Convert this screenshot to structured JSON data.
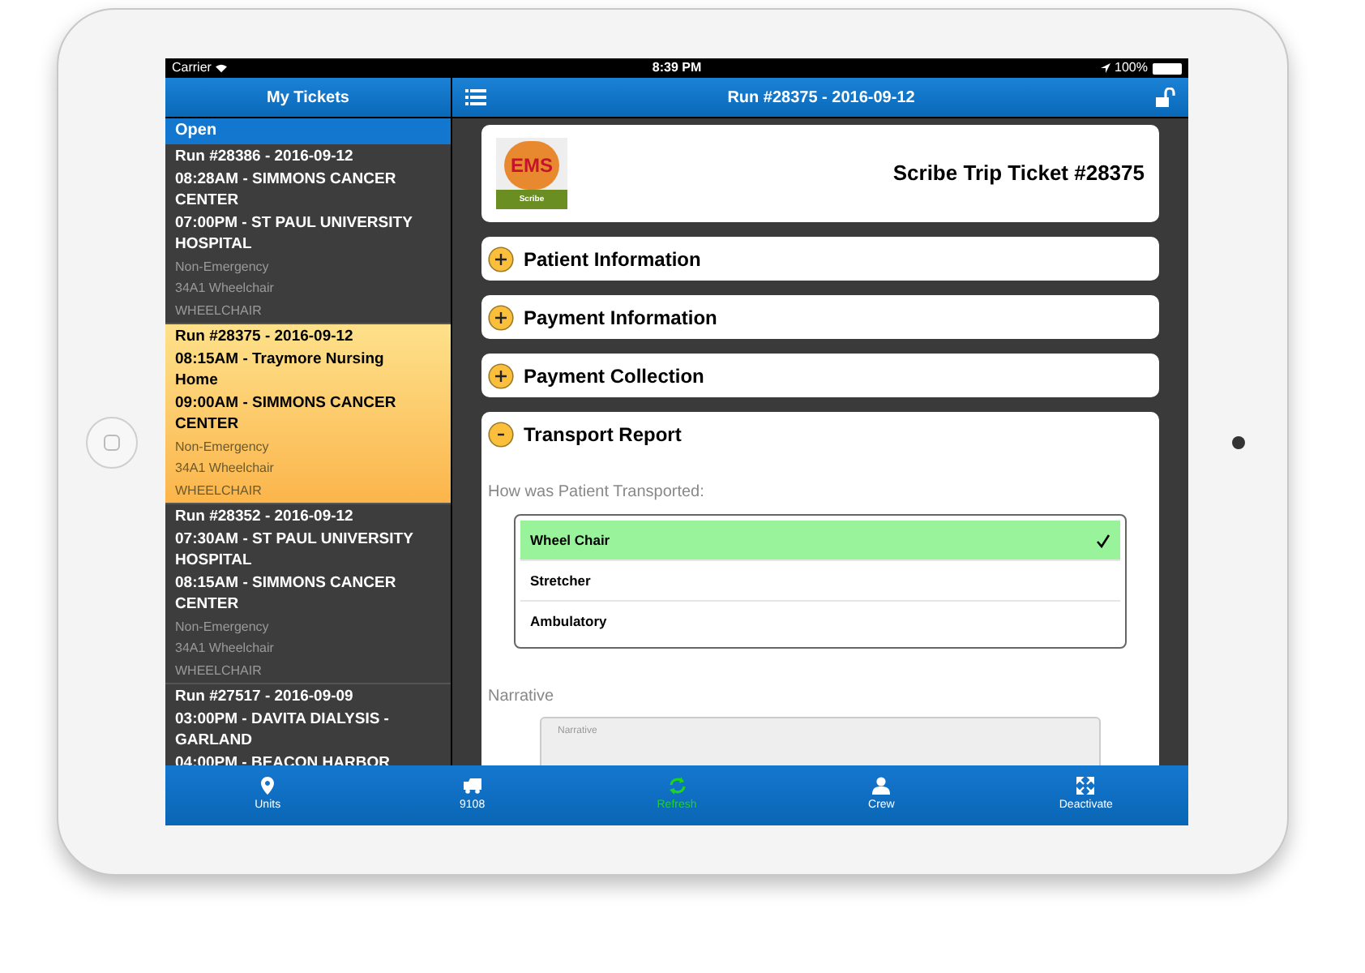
{
  "status_bar": {
    "carrier": "Carrier",
    "time": "8:39 PM",
    "battery": "100%"
  },
  "sidebar": {
    "title": "My Tickets",
    "section": "Open",
    "tickets": [
      {
        "run": "Run #28386 - 2016-09-12",
        "pickup": "08:28AM - SIMMONS CANCER CENTER",
        "dropoff": "07:00PM - ST PAUL UNIVERSITY HOSPITAL",
        "priority": "Non-Emergency",
        "unit": "34A1 Wheelchair",
        "mode": "WHEELCHAIR",
        "selected": false
      },
      {
        "run": "Run #28375 - 2016-09-12",
        "pickup": "08:15AM - Traymore Nursing Home",
        "dropoff": "09:00AM - SIMMONS CANCER CENTER",
        "priority": "Non-Emergency",
        "unit": "34A1 Wheelchair",
        "mode": "WHEELCHAIR",
        "selected": true
      },
      {
        "run": "Run #28352 - 2016-09-12",
        "pickup": "07:30AM - ST PAUL UNIVERSITY HOSPITAL",
        "dropoff": "08:15AM - SIMMONS CANCER CENTER",
        "priority": "Non-Emergency",
        "unit": "34A1 Wheelchair",
        "mode": "WHEELCHAIR",
        "selected": false
      },
      {
        "run": "Run #27517 - 2016-09-09",
        "pickup": "03:00PM - DAVITA DIALYSIS - GARLAND",
        "dropoff": "04:00PM - BEACON HARBOR",
        "selected": false
      }
    ]
  },
  "header": {
    "title": "Run #28375 - 2016-09-12"
  },
  "ticket_card": {
    "logo_text": "EMS",
    "logo_caption": "Scribe",
    "title": "Scribe Trip Ticket #28375"
  },
  "sections": [
    {
      "title": "Patient Information",
      "expanded": false
    },
    {
      "title": "Payment Information",
      "expanded": false
    },
    {
      "title": "Payment Collection",
      "expanded": false
    },
    {
      "title": "Transport Report",
      "expanded": true
    }
  ],
  "transport": {
    "question": "How was Patient Transported:",
    "options": [
      {
        "label": "Wheel Chair",
        "selected": true
      },
      {
        "label": "Stretcher",
        "selected": false
      },
      {
        "label": "Ambulatory",
        "selected": false
      }
    ],
    "narrative": {
      "label": "Narrative",
      "placeholder": "Narrative"
    }
  },
  "tabs": [
    {
      "kind": "pin",
      "label": "Units",
      "selected": false
    },
    {
      "kind": "truck",
      "label": "9108",
      "selected": false
    },
    {
      "kind": "refresh",
      "label": "Refresh",
      "selected": true
    },
    {
      "kind": "person",
      "label": "Crew",
      "selected": false
    },
    {
      "kind": "expand",
      "label": "Deactivate",
      "selected": false
    }
  ]
}
